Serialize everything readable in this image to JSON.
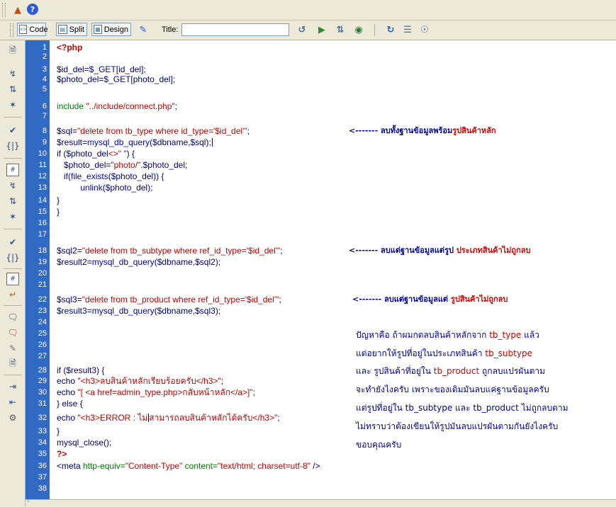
{
  "toolbar": {
    "code_label": "Code",
    "split_label": "Split",
    "design_label": "Design",
    "title_label": "Title:",
    "title_value": ""
  },
  "colors": {
    "gutter": "#316ac5",
    "code_text": "#000080",
    "string": "#cc0000",
    "function": "#0000cc",
    "php_tag": "#cc0000"
  },
  "line_numbers": [
    "1",
    "2",
    "3",
    "4",
    "5",
    "6",
    "7",
    "8",
    "9",
    "10",
    "11",
    "12",
    "13",
    "14",
    "15",
    "16",
    "17",
    "18",
    "19",
    "20",
    "21",
    "22",
    "23",
    "24",
    "25",
    "26",
    "27",
    "28",
    "29",
    "30",
    "31",
    "32",
    "33",
    "34",
    "35",
    "36",
    "37",
    "38"
  ],
  "code": {
    "l1": "<?php",
    "l3a": "$id_del=",
    "l3b": "$_GET",
    "l3c": "[id_del];",
    "l4a": "$photo_del=",
    "l4b": "$_GET",
    "l4c": "[photo_del];",
    "l6a": "include ",
    "l6b": "\"../include/connect.php\"",
    "l6c": ";",
    "l8a": "$sql=",
    "l8b": "\"delete from tb_type where id_type='$id_del'\"",
    "l8c": ";",
    "l9a": "$result=",
    "l9b": "mysql_db_query",
    "l9c": "($dbname,$sql);",
    "l10a": "if ($photo_del",
    "l10b": "<>\" \"",
    "l10c": ") {",
    "l11a": "   $photo_del=",
    "l11b": "\"photo/\"",
    "l11c": ".$photo_del;",
    "l12a": "   ",
    "l12b": "if(file_exists",
    "l12c": "($photo_del)) {",
    "l13a": "          ",
    "l13b": "unlink",
    "l13c": "($photo_del);",
    "l14": "}",
    "l15": "}",
    "l18a": "$sql2=",
    "l18b": "\"delete from tb_subtype where ref_id_type='$id_del'\"",
    "l18c": ";",
    "l19a": "$result2=",
    "l19b": "mysql_db_query",
    "l19c": "($dbname,$sql2);",
    "l22a": "$sql3=",
    "l22b": "\"delete from tb_product where ref_id_type='$id_del'\"",
    "l22c": ";",
    "l23a": "$result3=",
    "l23b": "mysql_db_query",
    "l23c": "($dbname,$sql3);",
    "l28": "if ($result3) {",
    "l29a": "echo ",
    "l29b": "\"<h3>ลบสินค้าหลักเรียบร้อยครับ</h3>\"",
    "l29c": ";",
    "l30a": "echo ",
    "l30b": "\"[ <a href=admin_type.php>กลับหน้าหลัก</a>]\"",
    "l30c": ";",
    "l31": "} else {",
    "l32a": "echo ",
    "l32b": "\"<h3>ERROR : ไม่",
    "l32c": "สามารถลบสินค้าหลักได้ครับ</h3>\"",
    "l32d": ";",
    "l33": "}",
    "l34": "mysql_close();",
    "l35": "?>",
    "l36a": "<meta ",
    "l36b": "http-equiv=",
    "l36c": "\"Content-Type\"",
    "l36d": " content=",
    "l36e": "\"text/html; charset=utf-8\"",
    "l36f": " />"
  },
  "notes": {
    "n1a": "<------- ลบทั้งฐานข้อมูลพร้อม",
    "n1b": "รูปสินค้าหลัก",
    "n2a": "<------- ลบแต่ฐานข้อมูลแต่รูป ",
    "n2b": "ประเภทสินค้าไม่ถูกลบ",
    "n3a": "<------- ลบแต่ฐานข้อมูลแต่ ",
    "n3b": "รูปสินค้าไม่ถูกลบ"
  },
  "question": {
    "p1a": "ปัญหาคือ ถ้าผมกดลบสินค้าหลักจาก ",
    "p1b": "tb_type",
    "p1c": " แล้ว",
    "p2a": "แต่อยากให้รูปที่อยู่ในประเภทสินค้า ",
    "p2b": "tb_subtype",
    "p3a": "และ รูปสินค้าที่อยู่ใน ",
    "p3b": "tb_product",
    "p3c": " ถูกลบแปรผันตาม",
    "p4": "จะทำยังไงครับ เพราะของเดิมมันลบแค่ฐานข้อมูลครับ",
    "p5": "แต่รูปที่อยู่ใน tb_subtype และ tb_product ไม่ถูกลบตาม",
    "p6": "ไม่ทราบว่าต้องเขียนให้รูปมันลบแปรผันตามกันยังไงครับ",
    "p7": "ขอบคุณครับ"
  }
}
